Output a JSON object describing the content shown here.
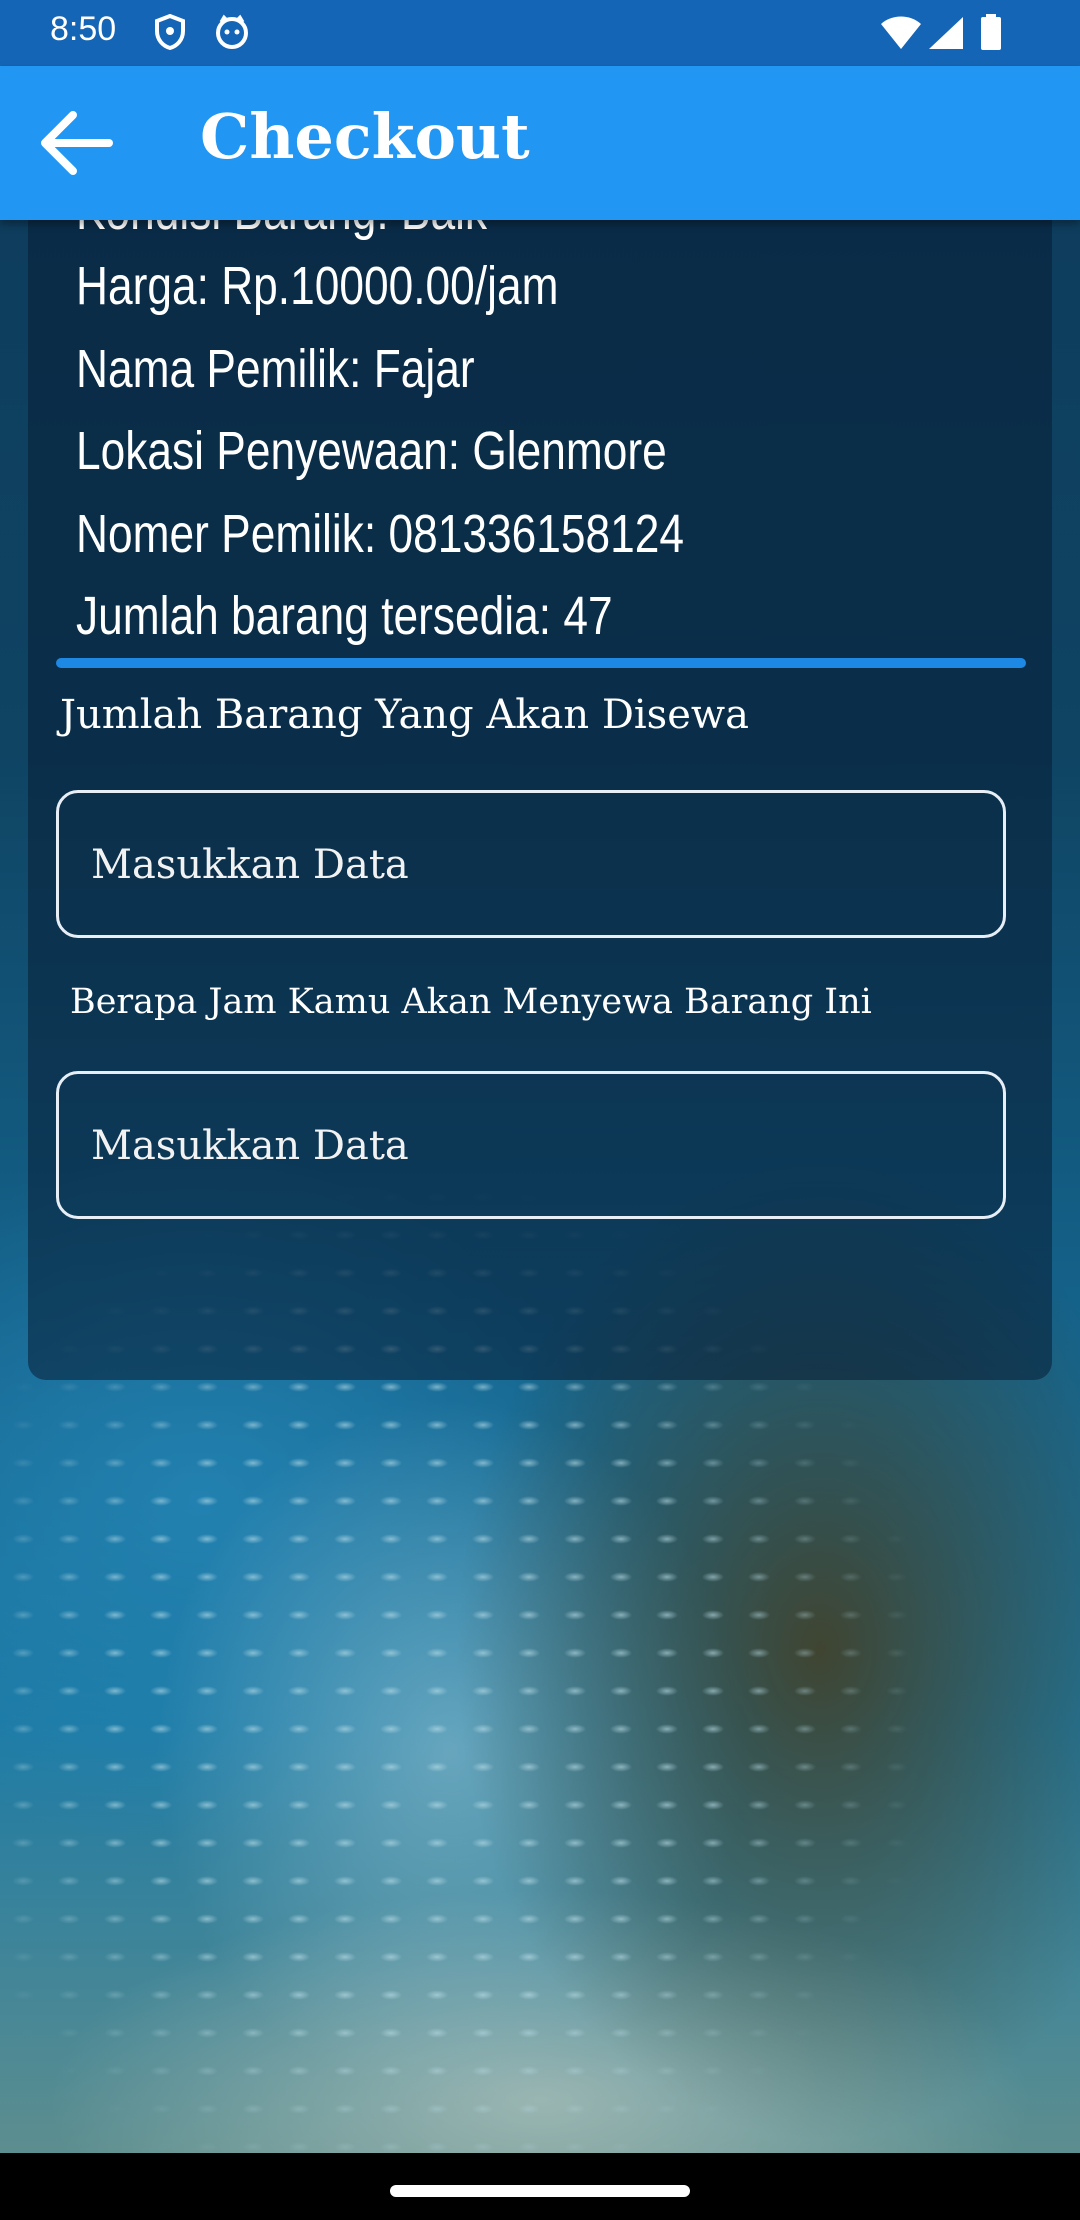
{
  "status_bar": {
    "time": "8:50"
  },
  "app_bar": {
    "title": "Checkout",
    "back_icon": "arrow-back-icon"
  },
  "details": {
    "lines": [
      "Kondisi Barang: Baik",
      "Harga: Rp.10000.00/jam",
      "Nama Pemilik: Fajar",
      "Lokasi Penyewaan: Glenmore",
      "Nomer Pemilik: 081336158124",
      "Jumlah barang tersedia: 47"
    ]
  },
  "form": {
    "qty_label": "Jumlah Barang Yang Akan Disewa",
    "qty_placeholder": "Masukkan Data",
    "hours_label": "Berapa Jam Kamu Akan Menyewa Barang Ini",
    "hours_placeholder": "Masukkan Data"
  },
  "colors": {
    "status_bar": "#1565b7",
    "app_bar": "#2196f3",
    "divider": "#1e88e5"
  }
}
